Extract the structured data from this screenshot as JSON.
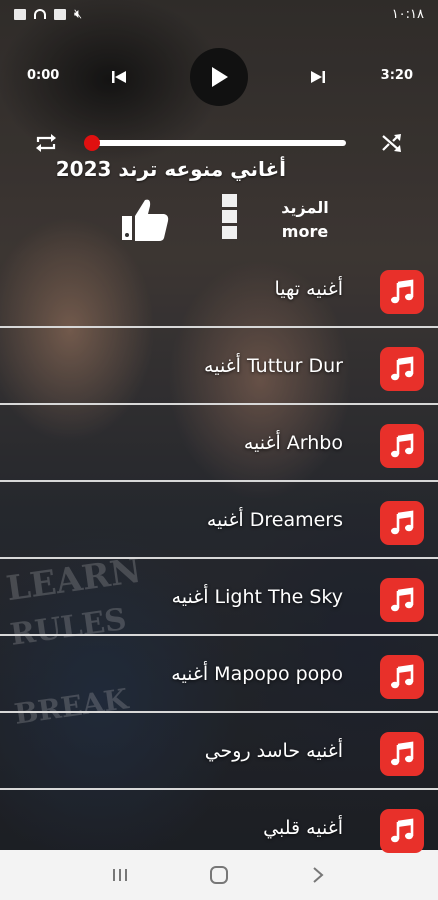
{
  "status_bar": {
    "time": "١٠:١٨"
  },
  "player": {
    "current_time": "0:00",
    "duration": "3:20",
    "progress": 0.0
  },
  "album": {
    "title": "أغاني منوعه ترند 2023",
    "more_label_ar": "المزيد",
    "more_label_en": "more"
  },
  "songs": [
    {
      "title": "أغنيه تهيا"
    },
    {
      "title": "أغنيه Tuttur Dur"
    },
    {
      "title": "أغنيه Arhbo"
    },
    {
      "title": "أغنيه Dreamers"
    },
    {
      "title": "أغنيه Light The Sky"
    },
    {
      "title": "أغنيه Mapopo popo"
    },
    {
      "title": "أغنيه حاسد روحي"
    },
    {
      "title": "أغنيه قلبي"
    }
  ],
  "colors": {
    "accent": "#e8302a",
    "seek_thumb": "#e01010",
    "nav_bg": "#f3f3f3"
  },
  "icons": {
    "song": "music-note-icon",
    "play": "play-icon",
    "prev": "skip-previous-icon",
    "next": "skip-next-icon",
    "repeat": "repeat-icon",
    "shuffle": "shuffle-icon",
    "like": "thumbs-up-icon"
  }
}
